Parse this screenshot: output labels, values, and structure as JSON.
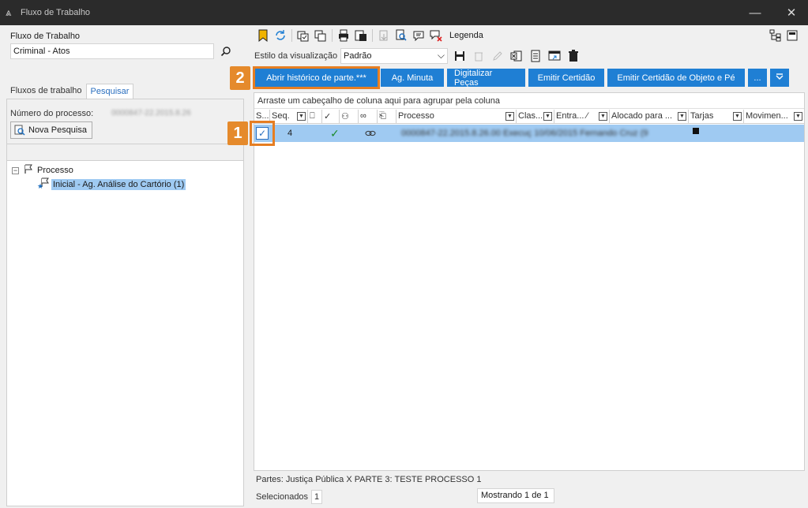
{
  "window": {
    "title": "Fluxo de Trabalho",
    "minimize": "—",
    "close": "✕"
  },
  "left": {
    "fluxo_label": "Fluxo de Trabalho",
    "fluxo_value": "Criminal - Atos",
    "tabs": [
      {
        "label": "Fluxos de trabalho"
      },
      {
        "label": "Pesquisar"
      }
    ],
    "numero_label": "Número do processo:",
    "numero_value": "0000847-22.2015.8.26",
    "nova_pesquisa": "Nova Pesquisa",
    "tree": {
      "root": "Processo",
      "child": "Inicial - Ag. Análise do Cartório (1)"
    }
  },
  "toolbar": {
    "legenda": "Legenda",
    "estilo_label": "Estilo da visualização",
    "estilo_value": "Padrão"
  },
  "actions": [
    {
      "label": "Abrir histórico de parte.***"
    },
    {
      "label": "Ag. Minuta"
    },
    {
      "label": "Digitalizar Peças"
    },
    {
      "label": "Emitir Certidão"
    },
    {
      "label": "Emitir Certidão de Objeto e Pé"
    },
    {
      "label": "..."
    }
  ],
  "callouts": {
    "one": "1",
    "two": "2"
  },
  "grid": {
    "group_hint": "Arraste um cabeçalho de coluna aqui para agrupar pela coluna",
    "headers": {
      "s": "S...",
      "seq": "Seq.",
      "processo": "Processo",
      "clas": "Clas...",
      "entra": "Entra... ⁄",
      "alocado": "Alocado para ...",
      "tarjas": "Tarjas",
      "movimen": "Movimen..."
    },
    "row": {
      "seq": "4",
      "processo": "0000847-22.2015.8.26.00 Execuç 10/06/2015 Fernando Cruz (9"
    }
  },
  "status": {
    "partes": "Partes: Justiça Pública  X  PARTE 3: TESTE PROCESSO 1",
    "selecionados_label": "Selecionados",
    "selecionados_value": "1",
    "mostrando": "Mostrando 1 de 1"
  }
}
